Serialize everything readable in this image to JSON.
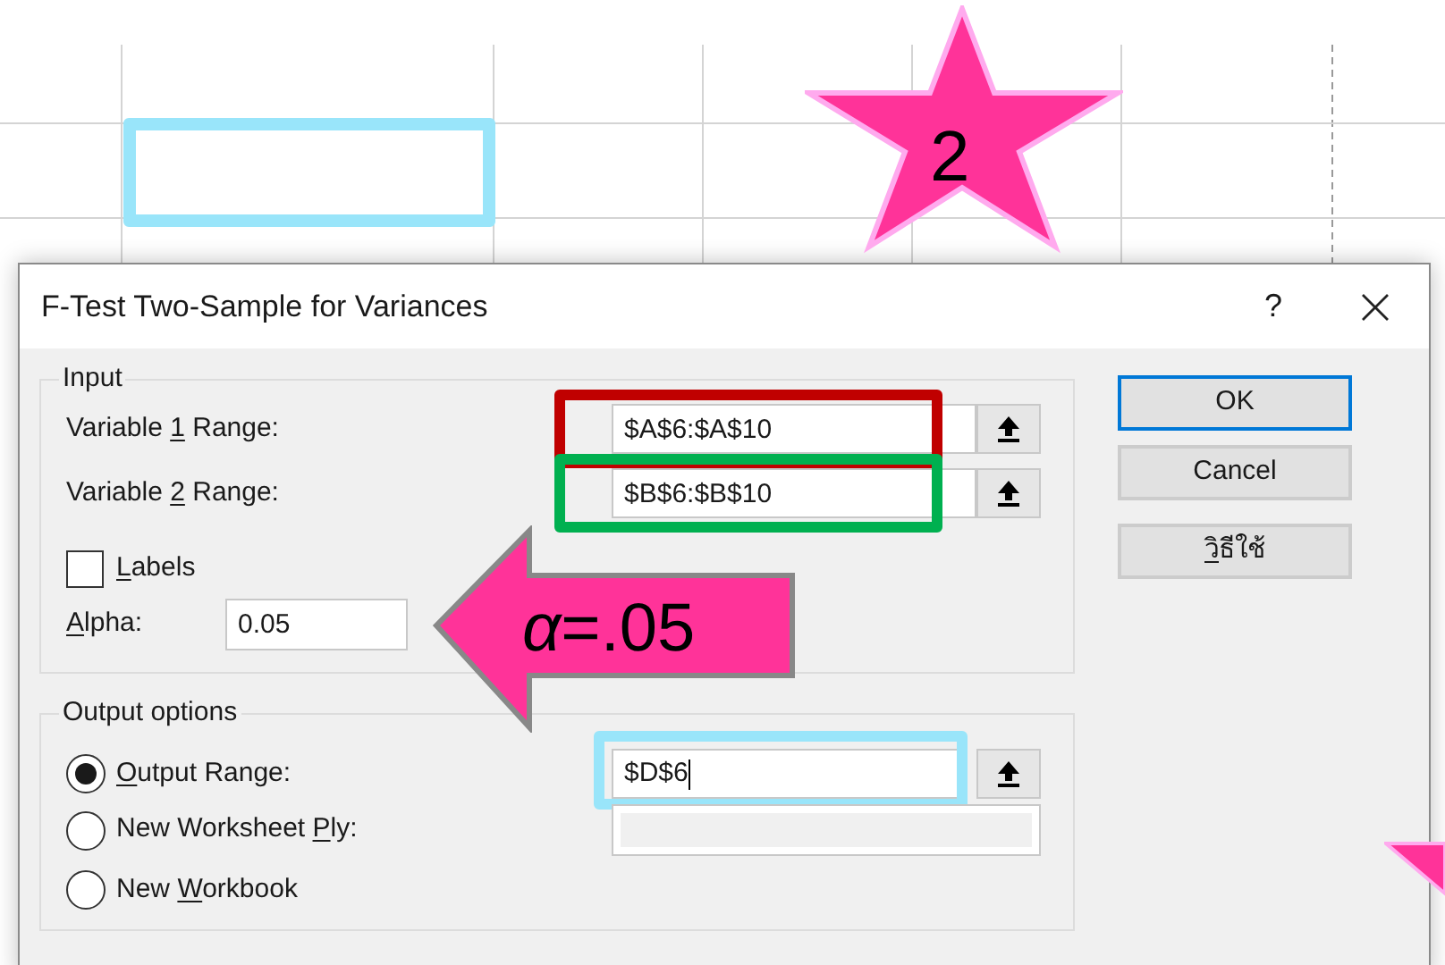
{
  "sheet": {
    "selected_cell": {
      "color": "#99e5fa"
    }
  },
  "star_callout": {
    "text": "2"
  },
  "arrow_callout": {
    "text": "*α*=.05"
  },
  "dialog": {
    "title": "F-Test Two-Sample for Variances",
    "help": "?",
    "input_group": {
      "legend": "Input",
      "ranges": [
        {
          "label": [
            {
              "text": "Variable "
            },
            {
              "text": "1",
              "underlined": true
            },
            {
              "text": " Range:"
            }
          ],
          "value": "$A$6:$A$10",
          "color": "#c00000"
        },
        {
          "label": [
            {
              "text": "Variable "
            },
            {
              "text": "2",
              "underlined": true
            },
            {
              "text": " Range:"
            }
          ],
          "value": "$B$6:$B$10",
          "color": "#00b050"
        }
      ],
      "labels_checkbox": {
        "label": [
          {
            "text": "L",
            "underlined": true
          },
          {
            "text": "abels"
          }
        ],
        "checked": false
      },
      "alpha": {
        "label": [
          {
            "text": "A",
            "underlined": true
          },
          {
            "text": "lpha:"
          }
        ],
        "value": "0.05"
      }
    },
    "output_group": {
      "legend": "Output options",
      "options": [
        {
          "label": [
            {
              "text": "O",
              "underlined": true
            },
            {
              "text": "utput Range:"
            }
          ],
          "selected": true,
          "kind": "range",
          "value": "$D$6",
          "color": "#99e5fa"
        },
        {
          "label": [
            {
              "text": "New Worksheet "
            },
            {
              "text": "P",
              "underlined": true
            },
            {
              "text": "ly:"
            }
          ],
          "selected": false,
          "kind": "disabled_field"
        },
        {
          "label": [
            {
              "text": "New "
            },
            {
              "text": "W",
              "underlined": true
            },
            {
              "text": "orkbook"
            }
          ],
          "selected": false,
          "kind": "plain"
        }
      ]
    },
    "buttons": [
      {
        "label": [
          {
            "text": "OK"
          }
        ],
        "default": true
      },
      {
        "label": [
          {
            "text": "Cancel"
          }
        ],
        "default": false
      },
      {
        "label": [
          {
            "text": "ว",
            "underlined": true
          },
          {
            "text": "ิธีใช้"
          }
        ],
        "default": false
      }
    ]
  }
}
